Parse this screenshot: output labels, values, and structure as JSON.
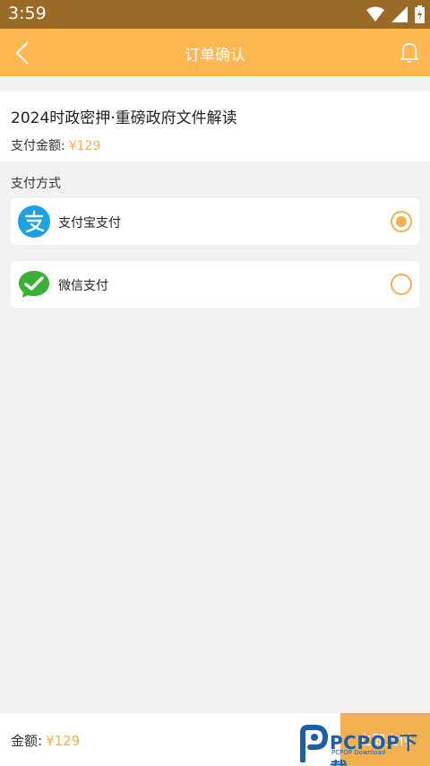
{
  "status_bar": {
    "time": "3:59",
    "icons": [
      "wifi-icon",
      "signal-icon",
      "battery-icon"
    ]
  },
  "nav": {
    "title": "订单确认",
    "icons": [
      "back-arrow-icon",
      "bell-icon"
    ]
  },
  "order": {
    "product_name": "2024时政密押·重磅政府文件解读",
    "amount_label": "支付金额:",
    "amount_value": "¥129"
  },
  "payment": {
    "section_label": "支付方式",
    "options": [
      {
        "label": "支付宝支付",
        "icon": "alipay-icon",
        "selected": true
      },
      {
        "label": "微信支付",
        "icon": "wechat-pay-icon",
        "selected": false
      }
    ]
  },
  "footer": {
    "total_label": "金额:",
    "total_value": "¥129",
    "submit_label": "立即支付"
  },
  "watermark": {
    "brand": "PCPOP下载",
    "sub": "PCPOP Download"
  },
  "colors": {
    "accent": "#ffb851",
    "price": "#f2b252",
    "status_bar": "#9b6a25"
  }
}
